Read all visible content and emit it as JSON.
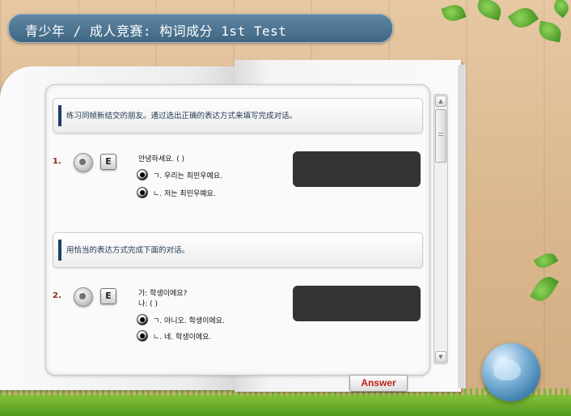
{
  "title": "青少年 / 成人竞赛: 构词成分 1st Test",
  "questions": [
    {
      "instruction": "练习同帧新结交的朋友。通过选出正确的表达方式来填写完成对话。",
      "number": "1.",
      "e_label": "E",
      "prompt_lines": [
        "안녕하세요. (        )"
      ],
      "options": [
        "ㄱ. 우리는 최민우예요.",
        "ㄴ. 저는 최민우예요."
      ]
    },
    {
      "instruction": "用恰当的表达方式完成下面的对话。",
      "number": "2.",
      "e_label": "E",
      "prompt_lines": [
        "가: 학생이에요?",
        "나: (        )"
      ],
      "options": [
        "ㄱ. 아니오. 학생이에요.",
        "ㄴ. 네. 학생이에요."
      ]
    }
  ],
  "answer_button": "Answer",
  "icons": {
    "audio": "speaker-icon",
    "scroll_up": "arrow-up-icon",
    "scroll_down": "arrow-down-icon",
    "globe": "globe-icon"
  },
  "colors": {
    "title_bar": "#4a7190",
    "question_number": "#8c2a1e",
    "instruction_mark": "#1e3d6b",
    "answer_text": "#c0211a",
    "answer_box": "#333333"
  }
}
